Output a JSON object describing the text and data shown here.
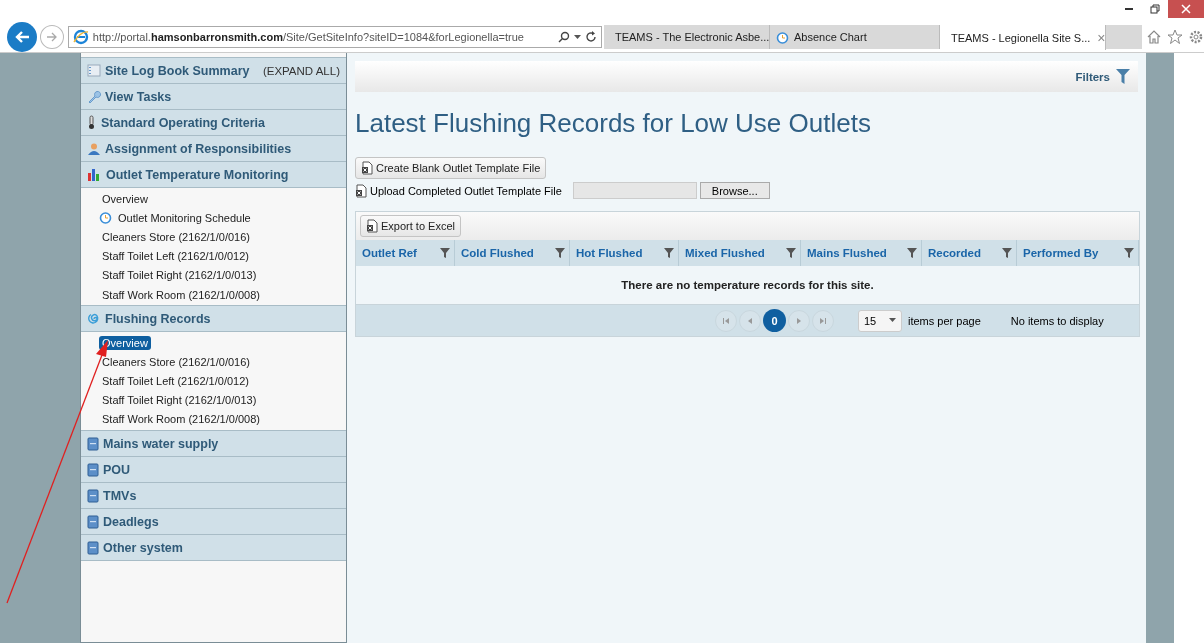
{
  "browser": {
    "address": "http://portal.**hamsonbarronsmith.com**/Site/GetSiteInfo?siteID=1084&forLegionella=true",
    "tabs": [
      {
        "label": "TEAMS - The Electronic Asbe...",
        "kind": "document",
        "selected": false
      },
      {
        "label": "Absence Chart",
        "kind": "clock",
        "selected": false
      },
      {
        "label": "TEAMS - Legionella Site S...",
        "kind": "ie",
        "selected": true
      }
    ],
    "close_tab": "×"
  },
  "sidebar": {
    "expand_all": "(EXPAND ALL)",
    "sections": [
      {
        "title": "Site Log Book Summary",
        "kind": "summary"
      },
      {
        "title": "View Tasks",
        "kind": "wrench"
      },
      {
        "title": "Standard Operating Criteria",
        "kind": "thermometer"
      },
      {
        "title": "Assignment of Responsibilities",
        "kind": "person"
      },
      {
        "title": "Outlet Temperature Monitoring",
        "kind": "chart",
        "items": [
          {
            "label": "Overview",
            "kind": "plain",
            "selected": false
          },
          {
            "label": "Outlet Monitoring Schedule",
            "kind": "clock",
            "selected": false
          },
          {
            "label": "Cleaners Store (2162/1/0/016)",
            "kind": "plain",
            "selected": false
          },
          {
            "label": "Staff Toilet Left (2162/1/0/012)",
            "kind": "plain",
            "selected": false
          },
          {
            "label": "Staff Toilet Right (2162/1/0/013)",
            "kind": "plain",
            "selected": false
          },
          {
            "label": "Staff Work Room (2162/1/0/008)",
            "kind": "plain",
            "selected": false
          }
        ]
      },
      {
        "title": "Flushing Records",
        "kind": "swirl",
        "items": [
          {
            "label": "Overview",
            "kind": "plain",
            "selected": true
          },
          {
            "label": "Cleaners Store (2162/1/0/016)",
            "kind": "plain",
            "selected": false
          },
          {
            "label": "Staff Toilet Left (2162/1/0/012)",
            "kind": "plain",
            "selected": false
          },
          {
            "label": "Staff Toilet Right (2162/1/0/013)",
            "kind": "plain",
            "selected": false
          },
          {
            "label": "Staff Work Room (2162/1/0/008)",
            "kind": "plain",
            "selected": false
          }
        ]
      },
      {
        "title": "Mains water supply",
        "kind": "book"
      },
      {
        "title": "POU",
        "kind": "book"
      },
      {
        "title": "TMVs",
        "kind": "book"
      },
      {
        "title": "Deadlegs",
        "kind": "book"
      },
      {
        "title": "Other system",
        "kind": "book"
      }
    ]
  },
  "main": {
    "filters": "Filters",
    "title": "Latest Flushing Records for Low Use Outlets",
    "create_button": "Create Blank Outlet Template File",
    "upload_label": "Upload Completed Outlet Template File",
    "browse_button": "Browse...",
    "grid": {
      "export_button": "Export to Excel",
      "columns": [
        "Outlet Ref",
        "Cold Flushed",
        "Hot Flushed",
        "Mixed Flushed",
        "Mains Flushed",
        "Recorded",
        "Performed By"
      ],
      "empty_message": "There are no temperature records for this site.",
      "pager": {
        "page": "0",
        "page_size": "15",
        "per_page_label": "items per page",
        "status": "No items to display"
      }
    }
  }
}
